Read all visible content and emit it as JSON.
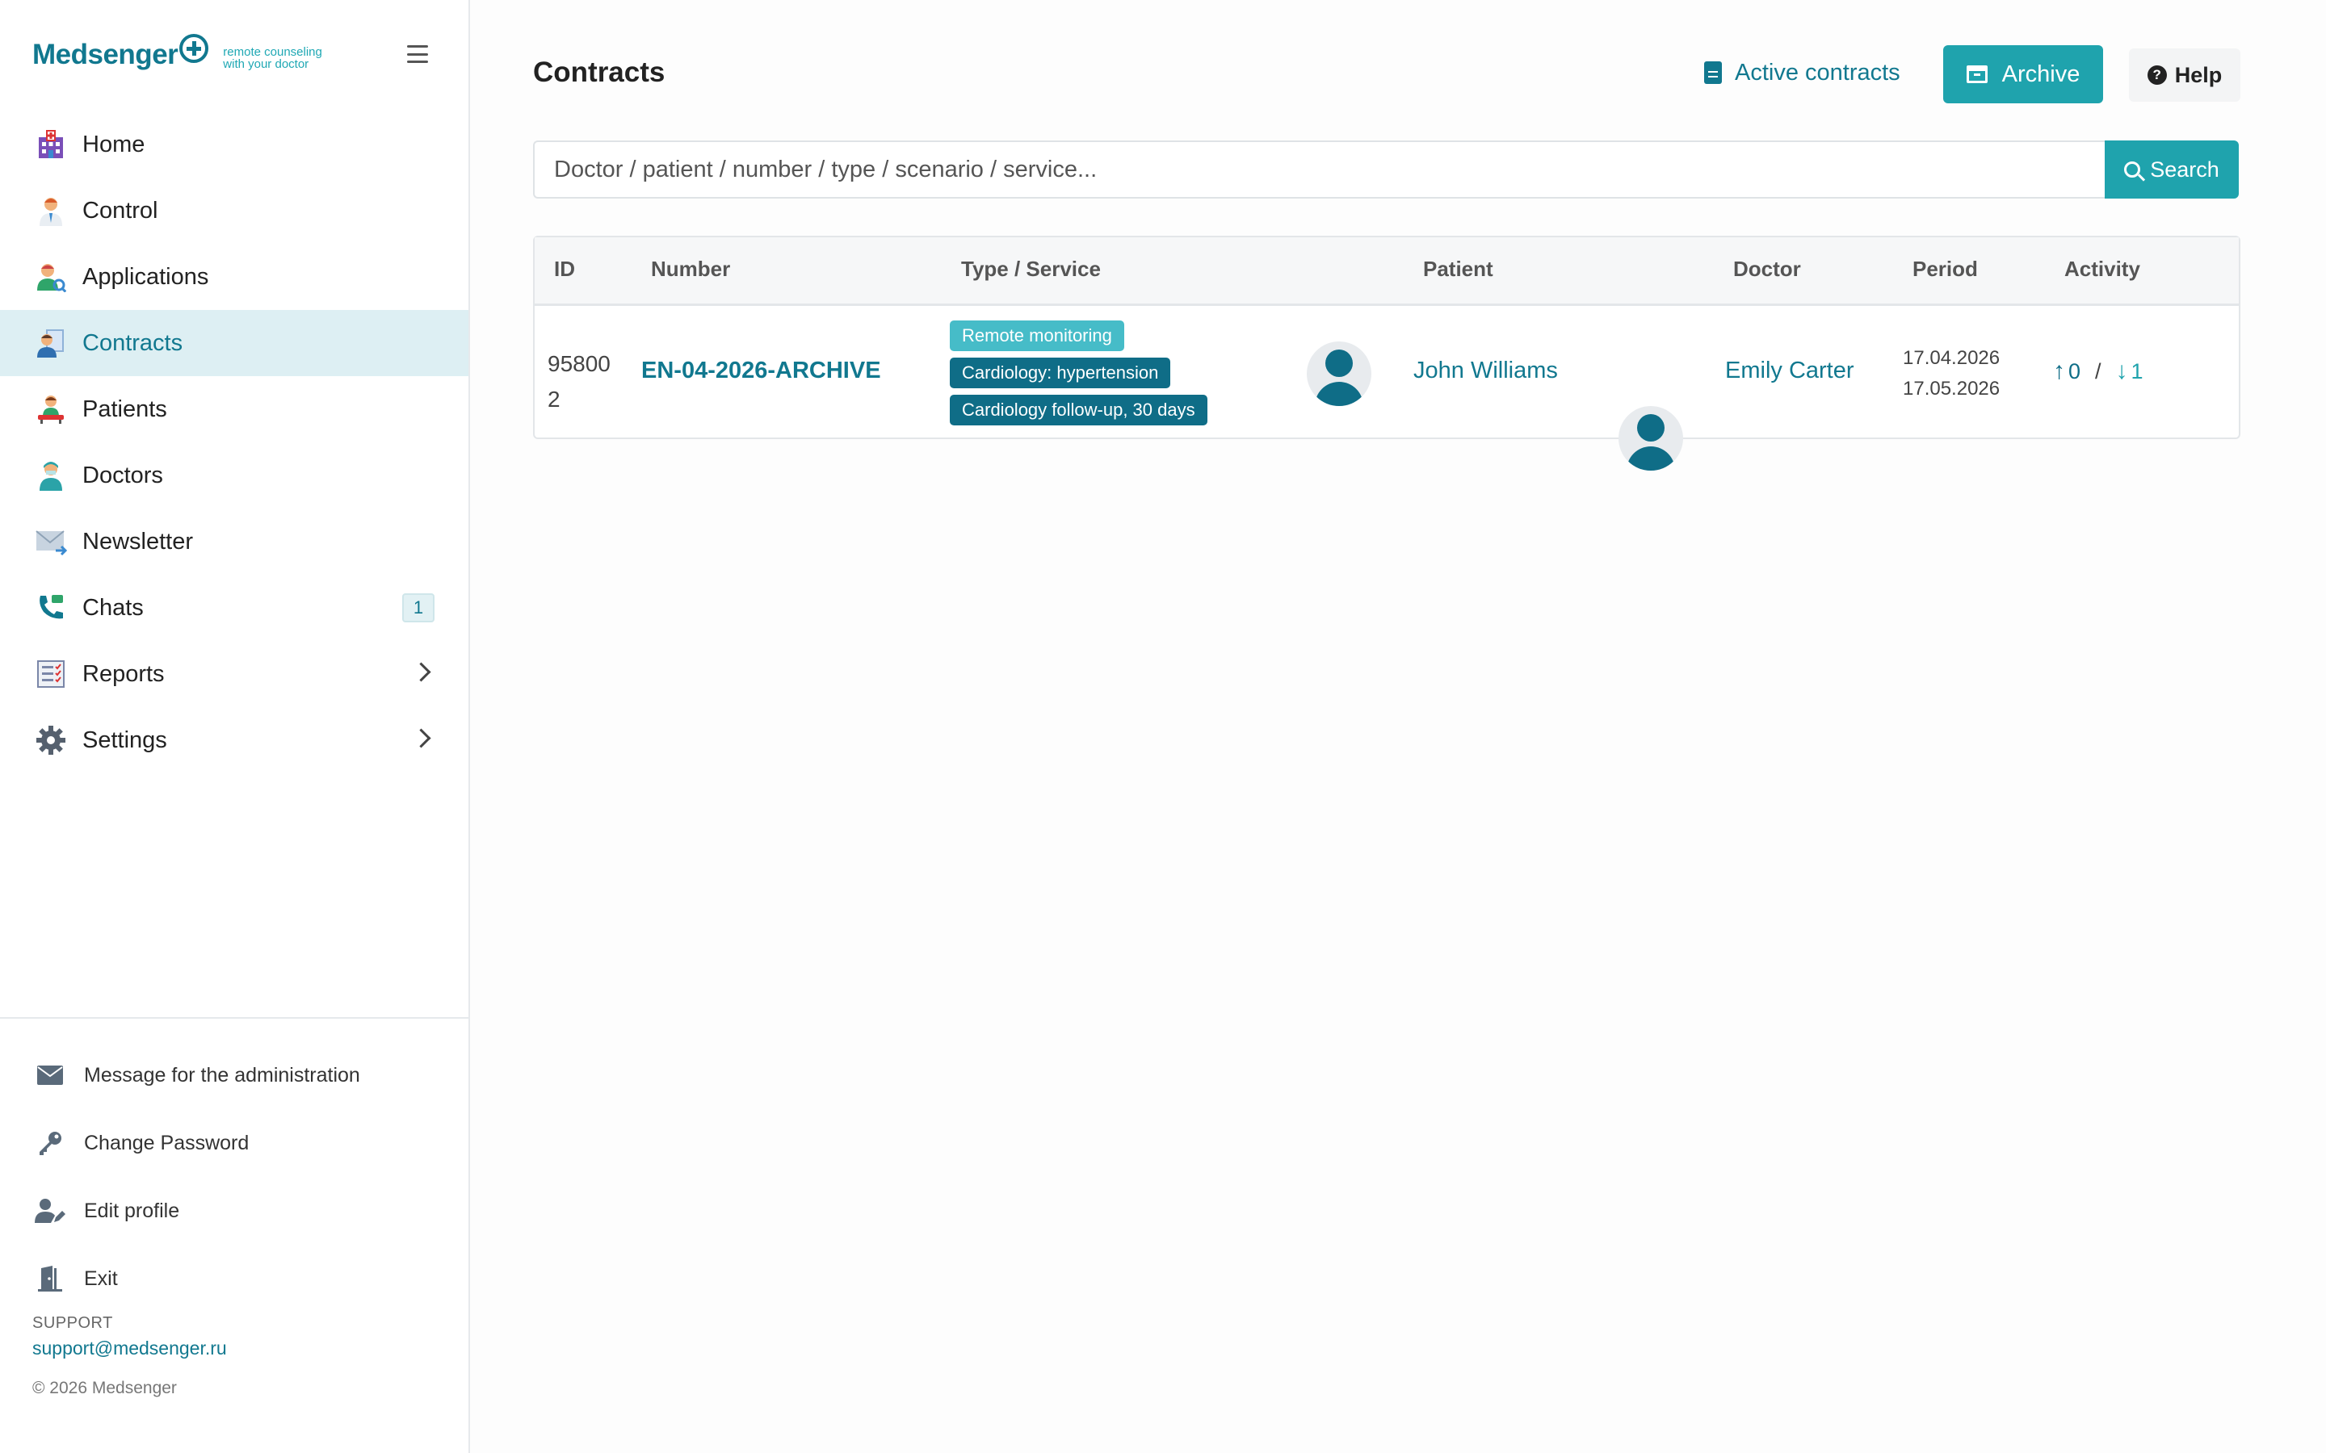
{
  "brand": {
    "name": "Medsenger",
    "tagline_line1": "remote counseling",
    "tagline_line2": "with your doctor"
  },
  "sidebar": {
    "items": [
      {
        "label": "Home",
        "icon": "hospital-icon"
      },
      {
        "label": "Control",
        "icon": "doctor-icon"
      },
      {
        "label": "Applications",
        "icon": "applications-icon"
      },
      {
        "label": "Contracts",
        "icon": "contracts-icon",
        "active": true
      },
      {
        "label": "Patients",
        "icon": "patients-icon"
      },
      {
        "label": "Doctors",
        "icon": "doctors-icon"
      },
      {
        "label": "Newsletter",
        "icon": "envelope-icon"
      },
      {
        "label": "Chats",
        "icon": "phone-icon",
        "badge": "1"
      },
      {
        "label": "Reports",
        "icon": "report-icon"
      },
      {
        "label": "Settings",
        "icon": "gear-icon"
      }
    ],
    "bottom": [
      {
        "label": "Message for the administration",
        "icon": "mail-icon"
      },
      {
        "label": "Change Password",
        "icon": "key-icon"
      },
      {
        "label": "Edit profile",
        "icon": "user-edit-icon"
      },
      {
        "label": "Exit",
        "icon": "door-icon"
      }
    ],
    "support_label": "SUPPORT",
    "support_email": "support@medsenger.ru",
    "copyright": "© 2026 Medsenger"
  },
  "header": {
    "title": "Contracts",
    "active_contracts": "Active contracts",
    "archive": "Archive",
    "help": "Help"
  },
  "search": {
    "placeholder": "Doctor / patient / number / type / scenario / service...",
    "button": "Search"
  },
  "table": {
    "columns": [
      "ID",
      "Number",
      "Type / Service",
      "Patient",
      "Doctor",
      "Period",
      "Activity"
    ],
    "rows": [
      {
        "id_line1": "95800",
        "id_line2": "2",
        "number": "EN-04-2026-ARCHIVE",
        "tags": [
          "Remote monitoring",
          "Cardiology: hypertension",
          "Cardiology follow-up, 30 days"
        ],
        "patient": "John Williams",
        "doctor": "Emily Carter",
        "period_start": "17.04.2026",
        "period_end": "17.05.2026",
        "activity_out": "0",
        "activity_sep": "/",
        "activity_in": "1"
      }
    ]
  },
  "colors": {
    "brand": "#11788f",
    "accent": "#1fa3ad",
    "active_bg": "#ddeff3",
    "tag_light": "#46bcc8",
    "tag_dark": "#0f6d87"
  }
}
